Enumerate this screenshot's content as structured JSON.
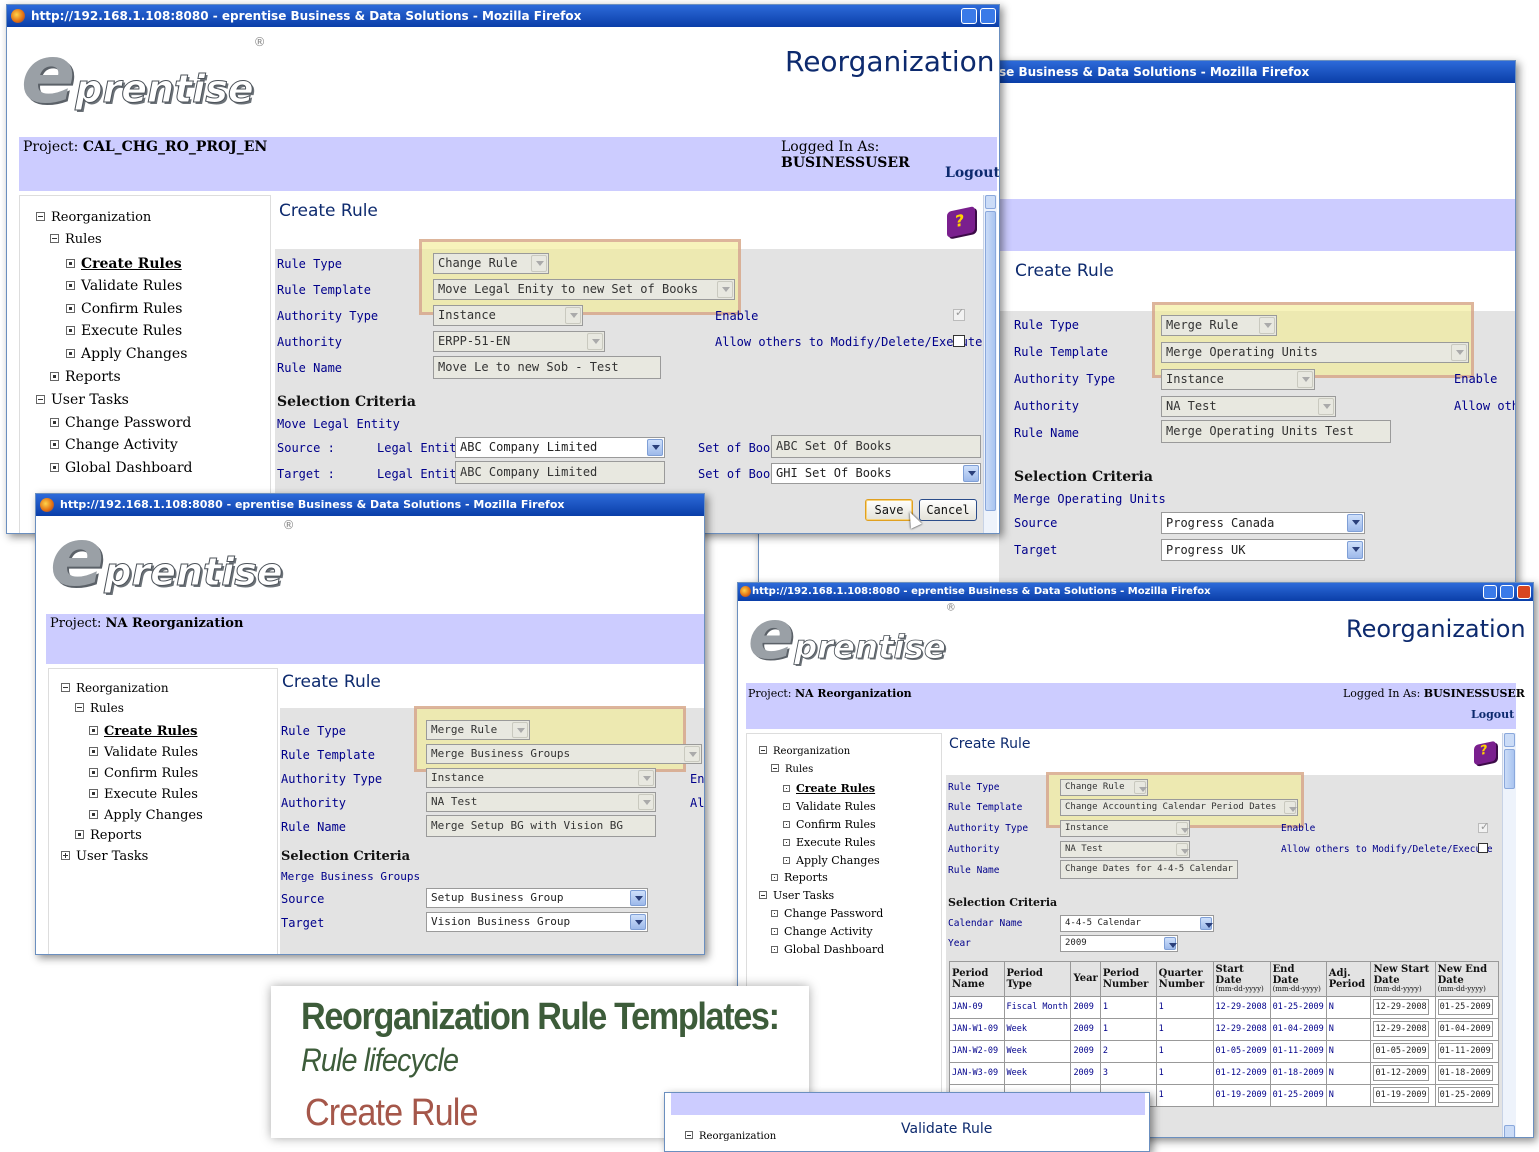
{
  "windows": {
    "title_full": "http://192.168.1.108:8080 - eprentise Business & Data Solutions - Mozilla Firefox",
    "title_partial": "se Business & Data Solutions - Mozilla Firefox"
  },
  "app": {
    "heading": "Reorganization",
    "logo_text": "prentise",
    "logo_initial": "e",
    "logo_mark": "®",
    "logged_label": "Logged In As:",
    "user": "BUSINESSUSER",
    "logout": "Logout",
    "project_label": "Project:"
  },
  "nav": {
    "reorganization": "Reorganization",
    "rules": "Rules",
    "create_rules": "Create Rules",
    "validate_rules": "Validate Rules",
    "confirm_rules": "Confirm Rules",
    "execute_rules": "Execute Rules",
    "apply_changes": "Apply Changes",
    "reports": "Reports",
    "user_tasks": "User Tasks",
    "change_password": "Change Password",
    "change_activity": "Change Activity",
    "global_dashboard": "Global Dashboard"
  },
  "labels": {
    "create_rule": "Create Rule",
    "validate_rule": "Validate Rule",
    "rule_type": "Rule Type",
    "rule_template": "Rule Template",
    "authority_type": "Authority Type",
    "authority": "Authority",
    "rule_name": "Rule Name",
    "enable": "Enable",
    "allow_others": "Allow others to Modify/Delete/Execute",
    "allow_others_cut": "Allow othe",
    "enable_cut": "En",
    "allow_cut": "All",
    "selection_criteria": "Selection Criteria",
    "source": "Source",
    "target": "Target",
    "source_colon": "Source :",
    "target_colon": "Target :",
    "legal_entity": "Legal Entity",
    "set_of_book": "Set of Book",
    "calendar_name": "Calendar Name",
    "year": "Year",
    "save": "Save",
    "cancel": "Cancel"
  },
  "win1": {
    "project": "CAL_CHG_RO_PROJ_EN",
    "rule_type": "Change Rule",
    "rule_template": "Move Legal Enity to new Set of Books",
    "authority_type": "Instance",
    "authority": "ERPP-51-EN",
    "rule_name": "Move Le to new Sob - Test",
    "criteria_title": "Move Legal Entity",
    "source_le": "ABC Company Limited",
    "source_sob": "ABC Set Of Books",
    "target_le": "ABC Company Limited",
    "target_sob": "GHI Set Of Books"
  },
  "win2": {
    "rule_type": "Merge Rule",
    "rule_template": "Merge Operating Units",
    "authority_type": "Instance",
    "authority": "NA Test",
    "rule_name": "Merge Operating Units Test",
    "criteria_title": "Merge Operating Units",
    "source": "Progress Canada",
    "target": "Progress UK"
  },
  "win3": {
    "project": "NA Reorganization",
    "rule_type": "Merge Rule",
    "rule_template": "Merge Business Groups",
    "authority_type": "Instance",
    "authority": "NA Test",
    "rule_name": "Merge Setup BG with Vision BG",
    "criteria_title": "Merge Business Groups",
    "source": "Setup Business Group",
    "target": "Vision Business Group"
  },
  "win4": {
    "project": "NA Reorganization",
    "rule_type": "Change Rule",
    "rule_template": "Change Accounting Calendar Period Dates",
    "authority_type": "Instance",
    "authority": "NA Test",
    "rule_name": "Change Dates for 4-4-5 Calendar",
    "calendar_name": "4-4-5 Calendar",
    "year": "2009",
    "columns": {
      "period_name": "Period Name",
      "period_type": "Period Type",
      "year": "Year",
      "period_number": "Period Number",
      "quarter_number": "Quarter Number",
      "start_date": "Start Date",
      "end_date": "End Date",
      "adj_period": "Adj. Period",
      "new_start_date": "New Start Date",
      "new_end_date": "New End Date",
      "date_fmt": "(mm-dd-yyyy)"
    },
    "rows": [
      [
        "JAN-09",
        "Fiscal Month",
        "2009",
        "1",
        "1",
        "12-29-2008",
        "01-25-2009",
        "N",
        "12-29-2008",
        "01-25-2009"
      ],
      [
        "JAN-W1-09",
        "Week",
        "2009",
        "1",
        "1",
        "12-29-2008",
        "01-04-2009",
        "N",
        "12-29-2008",
        "01-04-2009"
      ],
      [
        "JAN-W2-09",
        "Week",
        "2009",
        "2",
        "1",
        "01-05-2009",
        "01-11-2009",
        "N",
        "01-05-2009",
        "01-11-2009"
      ],
      [
        "JAN-W3-09",
        "Week",
        "2009",
        "3",
        "1",
        "01-12-2009",
        "01-18-2009",
        "N",
        "01-12-2009",
        "01-18-2009"
      ],
      [
        "",
        "",
        "",
        "",
        "1",
        "01-19-2009",
        "01-25-2009",
        "N",
        "01-19-2009",
        "01-25-2009"
      ]
    ]
  },
  "slide": {
    "title": "Reorganization Rule Templates:",
    "subtitle": "Rule lifecycle",
    "section": "Create Rule"
  }
}
